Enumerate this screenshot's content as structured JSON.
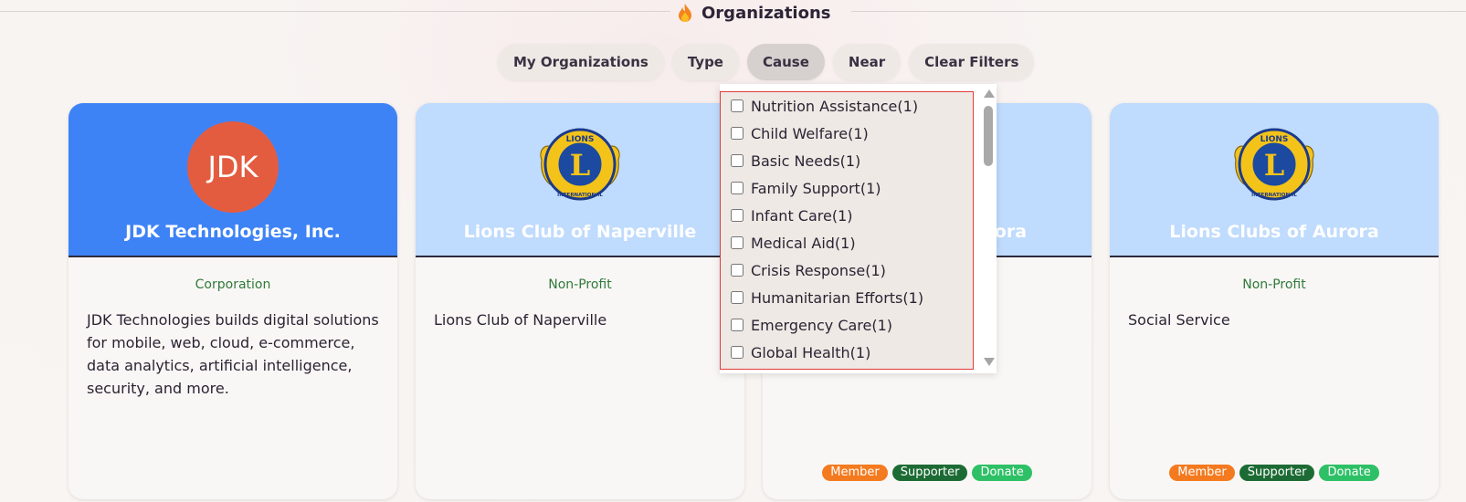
{
  "header": {
    "title": "Organizations",
    "title_icon": "flame-icon"
  },
  "filters": [
    {
      "label": "My Organizations",
      "active": false
    },
    {
      "label": "Type",
      "active": false
    },
    {
      "label": "Cause",
      "active": true
    },
    {
      "label": "Near",
      "active": false
    },
    {
      "label": "Clear Filters",
      "active": false
    }
  ],
  "cards": [
    {
      "name": "JDK Technologies, Inc.",
      "avatar_text": "JDK",
      "avatar_color": "#e45c3f",
      "header_color": "#3e83f6",
      "type": "Corporation",
      "description": "JDK Technologies builds digital solutions for mobile, web, cloud, e-commerce, data analytics, artificial intelligence, security, and more.",
      "badges": []
    },
    {
      "name": "Lions Club of Naperville",
      "logo": "lions-international-logo",
      "logo_text_top": "LIONS",
      "logo_letter": "L",
      "logo_text_bottom": "INTERNATIONAL",
      "header_color": "#bfdbfd",
      "type": "Non-Profit",
      "description": "Lions Club of Naperville",
      "badges": []
    },
    {
      "name": "Lions Club of Aurora",
      "logo": "lions-international-logo",
      "header_color": "#bfdbfd",
      "type": "Non-Profit",
      "description": "",
      "badges": [
        "Member",
        "Supporter",
        "Donate"
      ]
    },
    {
      "name": "Lions Clubs of Aurora",
      "logo": "lions-international-logo",
      "logo_text_top": "LIONS",
      "logo_letter": "L",
      "logo_text_bottom": "INTERNATIONAL",
      "header_color": "#bfdbfd",
      "type": "Non-Profit",
      "description": "Social Service",
      "badges": [
        "Member",
        "Supporter",
        "Donate"
      ]
    }
  ],
  "badge_colors": {
    "Member": "#f47a1f",
    "Supporter": "#1d6b34",
    "Donate": "#2ec066"
  },
  "cause_dropdown": {
    "options": [
      {
        "label": "Nutrition Assistance(1)",
        "checked": false
      },
      {
        "label": "Child Welfare(1)",
        "checked": false
      },
      {
        "label": "Basic Needs(1)",
        "checked": false
      },
      {
        "label": "Family Support(1)",
        "checked": false
      },
      {
        "label": "Infant Care(1)",
        "checked": false
      },
      {
        "label": "Medical Aid(1)",
        "checked": false
      },
      {
        "label": "Crisis Response(1)",
        "checked": false
      },
      {
        "label": "Humanitarian Efforts(1)",
        "checked": false
      },
      {
        "label": "Emergency Care(1)",
        "checked": false
      },
      {
        "label": "Global Health(1)",
        "checked": false
      }
    ]
  }
}
